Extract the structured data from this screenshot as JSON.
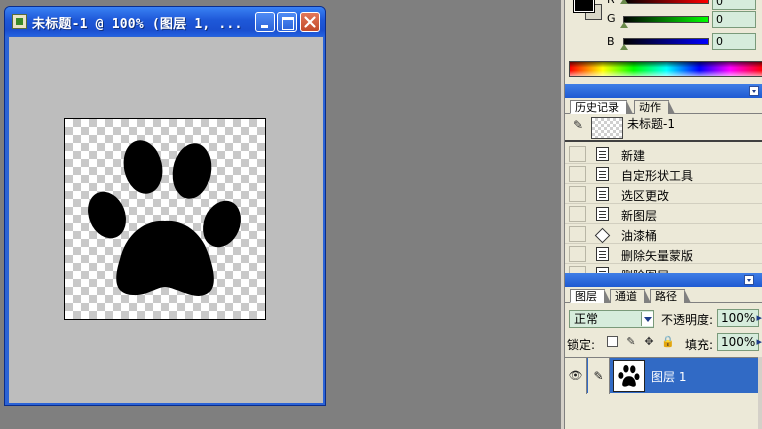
{
  "document": {
    "title": "未标题-1 @ 100% (图层 1, ..."
  },
  "color": {
    "channels": [
      {
        "label": "R",
        "value": "0"
      },
      {
        "label": "G",
        "value": "0"
      },
      {
        "label": "B",
        "value": "0"
      }
    ],
    "foreground": "#000000",
    "background": "#d8d6c8"
  },
  "history": {
    "tabs": [
      "历史记录",
      "动作"
    ],
    "snapshot": "未标题-1",
    "items": [
      "新建",
      "自定形状工具",
      "选区更改",
      "新图层",
      "油漆桶",
      "删除矢量蒙版",
      "删除图层"
    ]
  },
  "layers": {
    "tabs": [
      "图层",
      "通道",
      "路径"
    ],
    "blend_mode": "正常",
    "opacity_label": "不透明度:",
    "opacity_value": "100%",
    "lock_label": "锁定:",
    "fill_label": "填充:",
    "fill_value": "100%",
    "layer_name": "图层 1"
  },
  "colors": {
    "title_bar": "#1e58d8",
    "selection": "#316ac5",
    "canvas_bg": "#bdbdbd",
    "workspace": "#7f7f7f"
  }
}
